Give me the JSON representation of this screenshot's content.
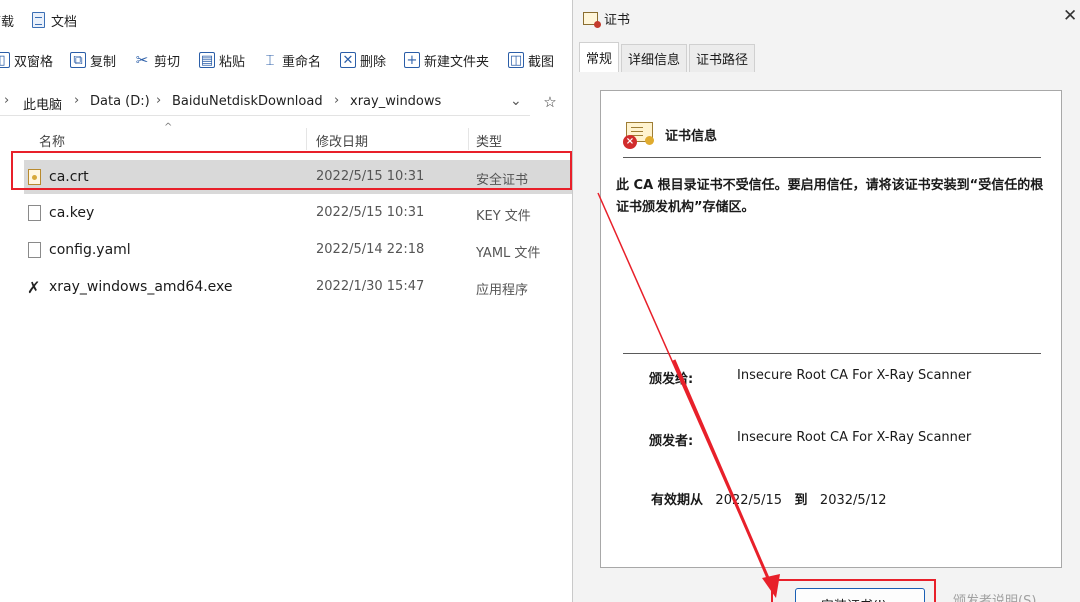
{
  "explorer": {
    "tabs": [
      {
        "label": "下载",
        "icon": "download-icon"
      },
      {
        "label": "文档",
        "icon": "document-icon"
      }
    ],
    "toolbar": {
      "new_window": "双窗格",
      "copy": "复制",
      "cut": "剪切",
      "paste": "粘贴",
      "rename": "重命名",
      "delete": "删除",
      "new_folder": "新建文件夹",
      "screenshot": "截图"
    },
    "breadcrumb": [
      "此电脑",
      "Data (D:)",
      "BaiduNetdiskDownload",
      "xray_windows"
    ],
    "columns": {
      "name": "名称",
      "modified": "修改日期",
      "type": "类型"
    },
    "files": [
      {
        "name": "ca.crt",
        "modified": "2022/5/15 10:31",
        "type": "安全证书",
        "icon": "certificate-file-icon",
        "selected": true
      },
      {
        "name": "ca.key",
        "modified": "2022/5/15 10:31",
        "type": "KEY 文件",
        "icon": "file-icon",
        "selected": false
      },
      {
        "name": "config.yaml",
        "modified": "2022/5/14 22:18",
        "type": "YAML 文件",
        "icon": "file-icon",
        "selected": false
      },
      {
        "name": "xray_windows_amd64.exe",
        "modified": "2022/1/30 15:47",
        "type": "应用程序",
        "icon": "executable-icon",
        "selected": false
      }
    ]
  },
  "dialog": {
    "title": "证书",
    "close": "✕",
    "tabs": [
      "常规",
      "详细信息",
      "证书路径"
    ],
    "info_title": "证书信息",
    "warning": "此 CA 根目录证书不受信任。要启用信任，请将该证书安装到“受信任的根证书颁发机构”存储区。",
    "issued_to_label": "颁发给:",
    "issued_to": "Insecure Root CA For X-Ray Scanner",
    "issued_by_label": "颁发者:",
    "issued_by": "Insecure Root CA For X-Ray Scanner",
    "validity_label": "有效期从",
    "valid_from": "2022/5/15",
    "to_label": "到",
    "valid_to": "2032/5/12",
    "install_button": "安装证书(I)...",
    "issuer_statement": "颁发者说明(S)"
  },
  "colors": {
    "highlight": "#e8202a",
    "arrow": "#e8202a",
    "accent": "#1a5fb4"
  }
}
